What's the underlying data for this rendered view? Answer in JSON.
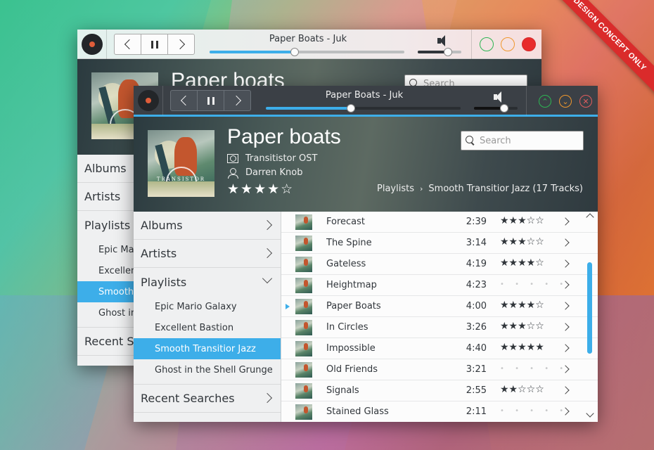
{
  "banner": "DESIGN CONCEPT ONLY",
  "back_window": {
    "title": "Paper Boats - Juk",
    "track_title": "Paper boats",
    "search_placeholder": "Search",
    "sidebar": {
      "albums": "Albums",
      "artists": "Artists",
      "playlists": "Playlists",
      "sub_items": [
        "Epic Mar",
        "Excellen",
        "Smooth",
        "Ghost in"
      ],
      "recent": "Recent Se"
    },
    "progress_percent": 43
  },
  "front_window": {
    "title": "Paper Boats - Juk",
    "progress_percent": 43,
    "volume_percent": 68,
    "now_playing": {
      "title": "Paper boats",
      "album": "Transitistor OST",
      "artist": "Darren Knob",
      "stars": "★★★★☆",
      "art_label": "TRANSISTOR"
    },
    "search": {
      "placeholder": "Search"
    },
    "breadcrumb": {
      "root": "Playlists",
      "separator": "›",
      "current": "Smooth Transitior Jazz (17 Tracks)"
    },
    "sidebar": {
      "albums": "Albums",
      "artists": "Artists",
      "playlists": "Playlists",
      "playlist_items": [
        "Epic Mario Galaxy",
        "Excellent Bastion",
        "Smooth Transitior Jazz",
        "Ghost in the Shell Grunge"
      ],
      "recent": "Recent Searches"
    },
    "tracks": [
      {
        "name": "Forecast",
        "duration": "2:39",
        "stars": "★★★☆☆"
      },
      {
        "name": "The Spine",
        "duration": "3:14",
        "stars": "★★★☆☆"
      },
      {
        "name": "Gateless",
        "duration": "4:19",
        "stars": "★★★★☆"
      },
      {
        "name": "Heightmap",
        "duration": "4:23",
        "stars": "• • • • •"
      },
      {
        "name": "Paper Boats",
        "duration": "4:00",
        "stars": "★★★★☆"
      },
      {
        "name": "In Circles",
        "duration": "3:26",
        "stars": "★★★☆☆"
      },
      {
        "name": "Impossible",
        "duration": "4:40",
        "stars": "★★★★★"
      },
      {
        "name": "Old Friends",
        "duration": "3:21",
        "stars": "• • • • •"
      },
      {
        "name": "Signals",
        "duration": "2:55",
        "stars": "★★☆☆☆"
      },
      {
        "name": "Stained Glass",
        "duration": "2:11",
        "stars": "• • • • •"
      }
    ]
  }
}
